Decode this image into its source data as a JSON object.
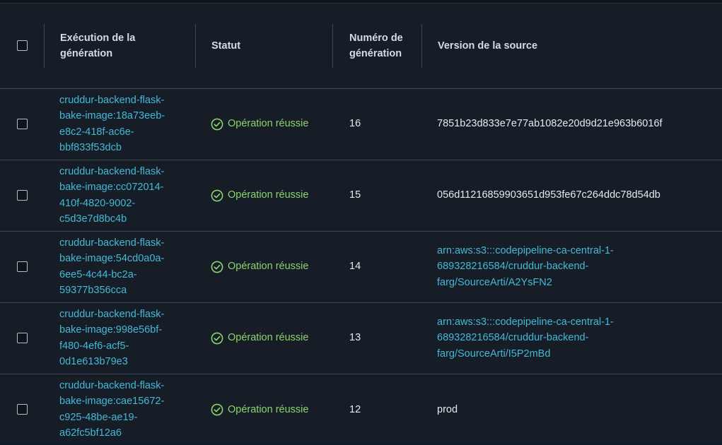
{
  "table": {
    "headers": {
      "select_all": "",
      "build_run": "Exécution de la génération",
      "status": "Statut",
      "build_number": "Numéro de génération",
      "source_version": "Version de la source"
    },
    "rows": [
      {
        "build_run": [
          "cruddur-backend-flask-",
          "bake-image:18a73eeb-",
          "e8c2-418f-ac6e-",
          "bbf833f53dcb"
        ],
        "status": "Opération réussie",
        "build_number": "16",
        "source_version": [
          "7851b23d833e7e77ab1082e20d9d21e963b6016f"
        ],
        "source_is_link": false
      },
      {
        "build_run": [
          "cruddur-backend-flask-",
          "bake-image:cc072014-",
          "410f-4820-9002-",
          "c5d3e7d8bc4b"
        ],
        "status": "Opération réussie",
        "build_number": "15",
        "source_version": [
          "056d11216859903651d953fe67c264ddc78d54db"
        ],
        "source_is_link": false
      },
      {
        "build_run": [
          "cruddur-backend-flask-",
          "bake-image:54cd0a0a-",
          "6ee5-4c44-bc2a-",
          "59377b356cca"
        ],
        "status": "Opération réussie",
        "build_number": "14",
        "source_version": [
          "arn:aws:s3:::codepipeline-ca-central-1-",
          "689328216584/cruddur-backend-",
          "farg/SourceArti/A2YsFN2"
        ],
        "source_is_link": true
      },
      {
        "build_run": [
          "cruddur-backend-flask-",
          "bake-image:998e56bf-",
          "f480-4ef6-acf5-",
          "0d1e613b79e3"
        ],
        "status": "Opération réussie",
        "build_number": "13",
        "source_version": [
          "arn:aws:s3:::codepipeline-ca-central-1-",
          "689328216584/cruddur-backend-",
          "farg/SourceArti/I5P2mBd"
        ],
        "source_is_link": true
      },
      {
        "build_run": [
          "cruddur-backend-flask-",
          "bake-image:cae15672-",
          "c925-48be-ae19-",
          "a62fc5bf12a6"
        ],
        "status": "Opération réussie",
        "build_number": "12",
        "source_version": [
          "prod"
        ],
        "source_is_link": false
      }
    ]
  },
  "colors": {
    "link": "#44b9d6",
    "success": "#8bd36c",
    "background": "#161d26"
  },
  "icons": {
    "status": "check-circle-icon"
  }
}
